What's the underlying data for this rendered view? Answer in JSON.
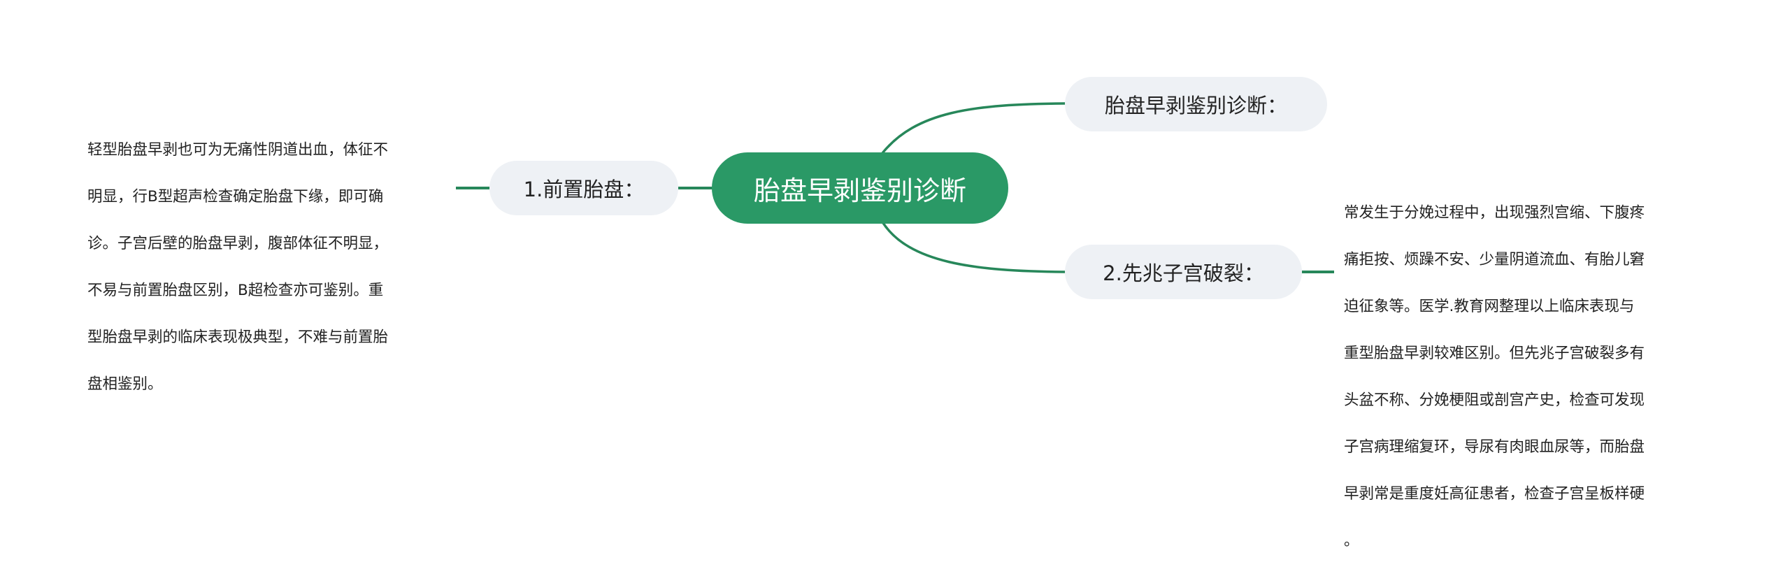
{
  "mindmap": {
    "root": {
      "label": "胎盘早剥鉴别诊断"
    },
    "branches": [
      {
        "id": "placenta-previa",
        "label": "1.前置胎盘：",
        "side": "left",
        "detail_lines": [
          "轻型胎盘早剥也可为无痛性阴道出血，体征不",
          "明显，行B型超声检查确定胎盘下缘，即可确",
          "诊。子宫后壁的胎盘早剥，腹部体征不明显，",
          "不易与前置胎盘区别，B超检查亦可鉴别。重",
          "型胎盘早剥的临床表现极典型，不难与前置胎",
          "盘相鉴别。"
        ]
      },
      {
        "id": "differential-title",
        "label": "胎盘早剥鉴别诊断：",
        "side": "right",
        "detail_lines": []
      },
      {
        "id": "threatened-uterine-rupture",
        "label": "2.先兆子宫破裂：",
        "side": "right",
        "detail_lines": [
          "常发生于分娩过程中，出现强烈宫缩、下腹疼",
          "痛拒按、烦躁不安、少量阴道流血、有胎儿窘",
          "迫征象等。医学.教育网整理以上临床表现与",
          "重型胎盘早剥较难区别。但先兆子宫破裂多有",
          "头盆不称、分娩梗阻或剖宫产史，检查可发现",
          "子宫病理缩复环，导尿有肉眼血尿等，而胎盘",
          "早剥常是重度妊高征患者，检查子宫呈板样硬",
          "。"
        ]
      }
    ],
    "colors": {
      "root_fill": "#2a9966",
      "root_text": "#ffffff",
      "branch_fill": "#eef1f5",
      "branch_text": "#222222",
      "connector": "#27875a",
      "leaf_text": "#222222",
      "background": "#ffffff"
    }
  }
}
